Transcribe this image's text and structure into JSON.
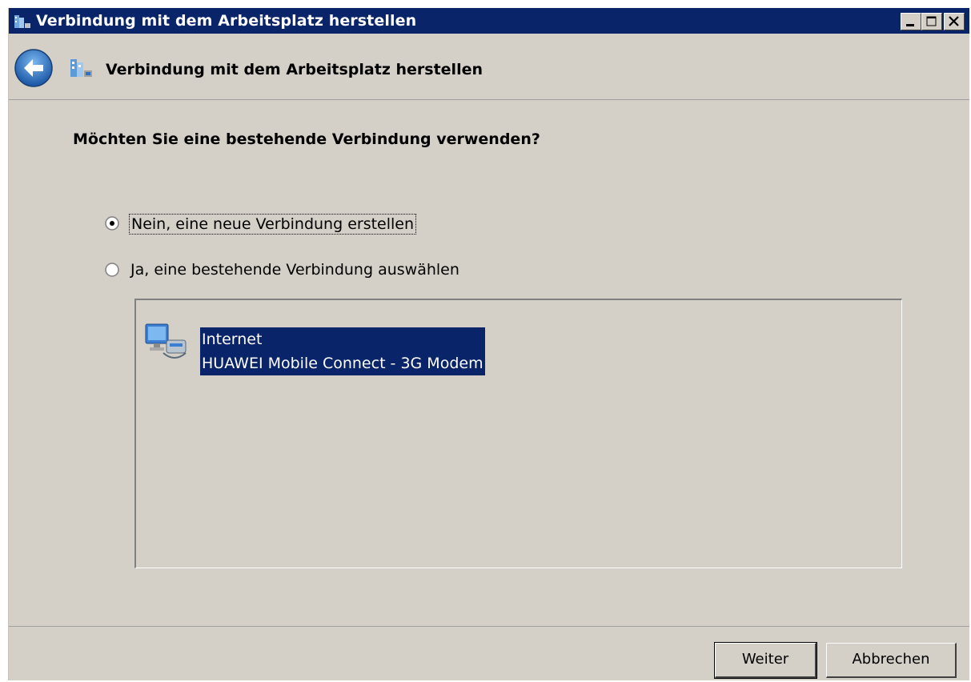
{
  "window": {
    "title": "Verbindung mit dem Arbeitsplatz herstellen"
  },
  "header": {
    "title": "Verbindung mit dem Arbeitsplatz herstellen"
  },
  "main": {
    "question": "Möchten Sie eine bestehende Verbindung verwenden?",
    "options": [
      {
        "label": "Nein, eine neue Verbindung erstellen",
        "selected": true
      },
      {
        "label": "Ja, eine bestehende Verbindung auswählen",
        "selected": false
      }
    ],
    "connections": [
      {
        "name": "Internet",
        "device": "HUAWEI Mobile Connect - 3G Modem",
        "selected": true,
        "icon": "network-connection-icon"
      }
    ]
  },
  "buttons": {
    "next": "Weiter",
    "cancel": "Abbrechen"
  },
  "colors": {
    "titlebar": "#0a246a",
    "selection": "#0a246a",
    "face": "#d4d0c8"
  }
}
